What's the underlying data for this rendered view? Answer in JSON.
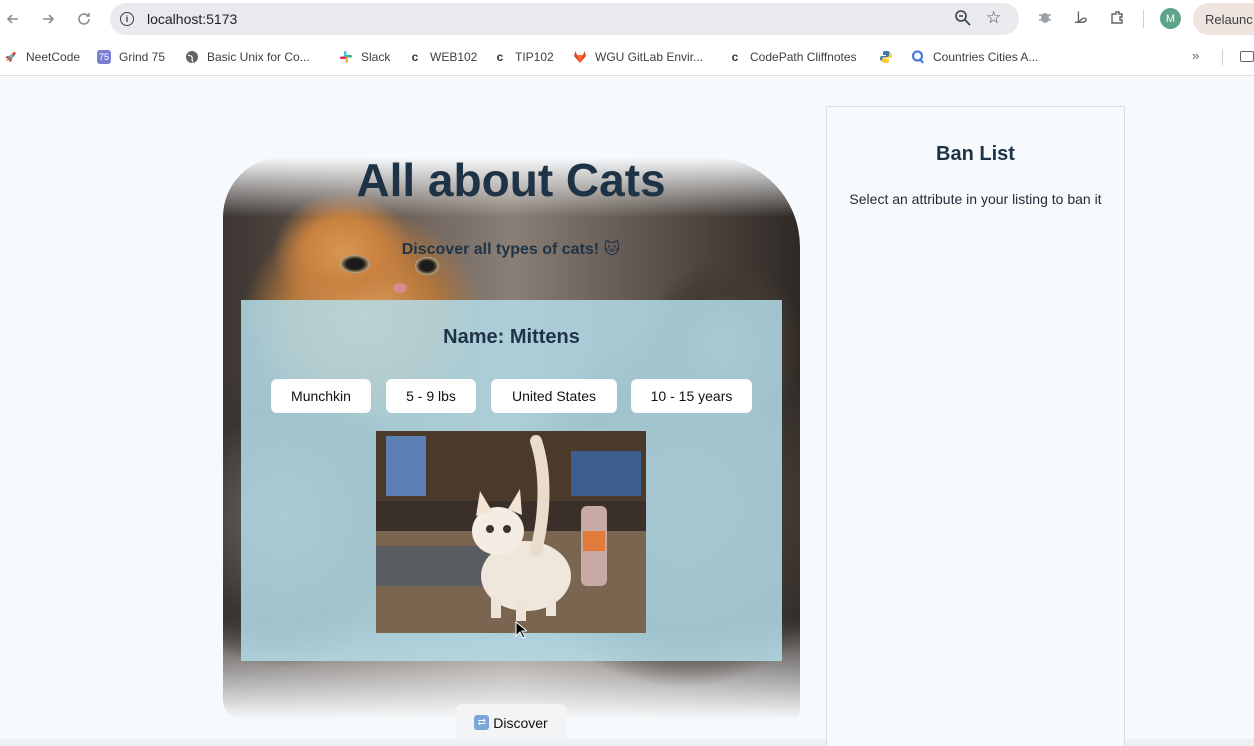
{
  "browser": {
    "url": "localhost:5173",
    "profile_initial": "M",
    "relaunch_label": "Relaunc",
    "bookmarks": [
      {
        "label": "NeetCode",
        "icon": "rocket-icon"
      },
      {
        "label": "Grind 75",
        "icon": "grind75-icon",
        "badge": "75"
      },
      {
        "label": "Basic Unix for Co...",
        "icon": "globe-icon"
      },
      {
        "label": "Slack",
        "icon": "slack-icon"
      },
      {
        "label": "WEB102",
        "icon": "codepath-icon"
      },
      {
        "label": "TIP102",
        "icon": "codepath-icon"
      },
      {
        "label": "WGU GitLab Envir...",
        "icon": "gitlab-icon"
      },
      {
        "label": "CodePath Cliffnotes",
        "icon": "codepath-icon"
      },
      {
        "label": "",
        "icon": "python-icon"
      },
      {
        "label": "Countries Cities A...",
        "icon": "search-app-icon"
      }
    ]
  },
  "app": {
    "title": "All about Cats",
    "subtitle": "Discover all types of cats! 🐱",
    "card": {
      "name_label": "Name: Mittens",
      "attributes": [
        "Munchkin",
        "5 - 9 lbs",
        "United States",
        "10 - 15 years"
      ]
    },
    "discover_label": "Discover",
    "ban_list": {
      "title": "Ban List",
      "description": "Select an attribute in your listing to ban it"
    }
  }
}
